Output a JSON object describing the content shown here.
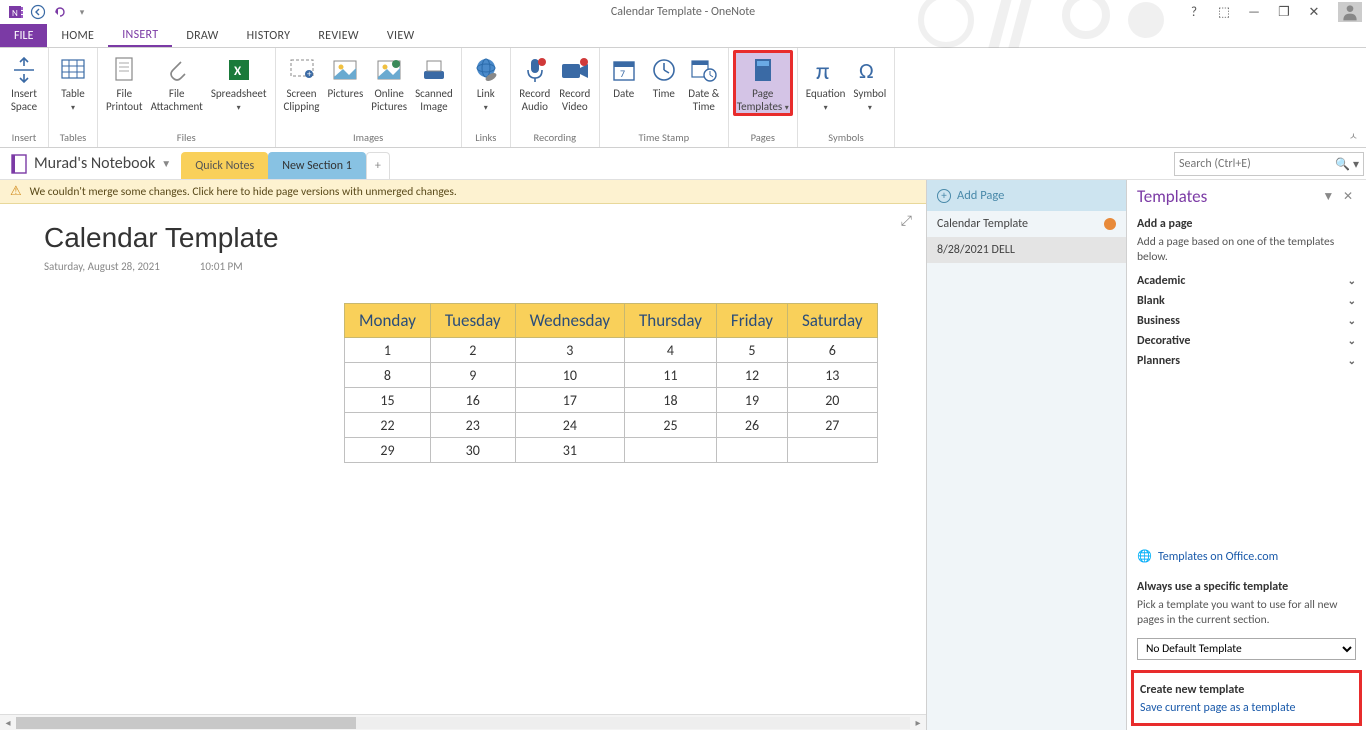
{
  "window": {
    "title": "Calendar Template - OneNote"
  },
  "titlebar_controls": {
    "help": "?",
    "fullscreen": "⬚",
    "minimize": "—",
    "restore": "❐",
    "close": "✕"
  },
  "menu": {
    "file": "FILE",
    "tabs": [
      "HOME",
      "INSERT",
      "DRAW",
      "HISTORY",
      "REVIEW",
      "VIEW"
    ],
    "active": "INSERT"
  },
  "ribbon": {
    "groups": [
      {
        "label": "Insert",
        "items": [
          {
            "label": "Insert\nSpace",
            "drop": false
          }
        ]
      },
      {
        "label": "Tables",
        "items": [
          {
            "label": "Table",
            "drop": true
          }
        ]
      },
      {
        "label": "Files",
        "items": [
          {
            "label": "File\nPrintout"
          },
          {
            "label": "File\nAttachment"
          },
          {
            "label": "Spreadsheet",
            "drop": true
          }
        ]
      },
      {
        "label": "Images",
        "items": [
          {
            "label": "Screen\nClipping"
          },
          {
            "label": "Pictures"
          },
          {
            "label": "Online\nPictures"
          },
          {
            "label": "Scanned\nImage"
          }
        ]
      },
      {
        "label": "Links",
        "items": [
          {
            "label": "Link"
          }
        ]
      },
      {
        "label": "Recording",
        "items": [
          {
            "label": "Record\nAudio"
          },
          {
            "label": "Record\nVideo"
          }
        ]
      },
      {
        "label": "Time Stamp",
        "items": [
          {
            "label": "Date"
          },
          {
            "label": "Time"
          },
          {
            "label": "Date &\nTime"
          }
        ]
      },
      {
        "label": "Pages",
        "items": [
          {
            "label": "Page\nTemplates",
            "drop": true,
            "highlight": true
          }
        ]
      },
      {
        "label": "Symbols",
        "items": [
          {
            "label": "Equation",
            "drop": true
          },
          {
            "label": "Symbol",
            "drop": true
          }
        ]
      }
    ]
  },
  "notebook": {
    "name": "Murad's Notebook",
    "sections": [
      {
        "label": "Quick Notes",
        "color": "yellow"
      },
      {
        "label": "New Section 1",
        "color": "blue",
        "active": true
      }
    ],
    "search_placeholder": "Search (Ctrl+E)"
  },
  "merge_warning": "We couldn't merge some changes. Click here to hide page versions with unmerged changes.",
  "page": {
    "title": "Calendar Template",
    "date": "Saturday, August 28, 2021",
    "time": "10:01 PM",
    "calendar": {
      "headers": [
        "Monday",
        "Tuesday",
        "Wednesday",
        "Thursday",
        "Friday",
        "Saturday"
      ],
      "rows": [
        [
          "1",
          "2",
          "3",
          "4",
          "5",
          "6"
        ],
        [
          "8",
          "9",
          "10",
          "11",
          "12",
          "13"
        ],
        [
          "15",
          "16",
          "17",
          "18",
          "19",
          "20"
        ],
        [
          "22",
          "23",
          "24",
          "25",
          "26",
          "27"
        ],
        [
          "29",
          "30",
          "31",
          "",
          "",
          ""
        ]
      ]
    }
  },
  "page_list": {
    "add": "Add Page",
    "items": [
      {
        "label": "Calendar Template",
        "conflict": true
      },
      {
        "label": "8/28/2021 DELL",
        "selected": true
      }
    ]
  },
  "templates": {
    "title": "Templates",
    "add_heading": "Add a page",
    "add_desc": "Add a page based on one of the templates below.",
    "categories": [
      "Academic",
      "Blank",
      "Business",
      "Decorative",
      "Planners"
    ],
    "office_link": "Templates on Office.com",
    "always_heading": "Always use a specific template",
    "always_desc": "Pick a template you want to use for all new pages in the current section.",
    "default_option": "No Default Template",
    "create_heading": "Create new template",
    "save_link": "Save current page as a template"
  }
}
